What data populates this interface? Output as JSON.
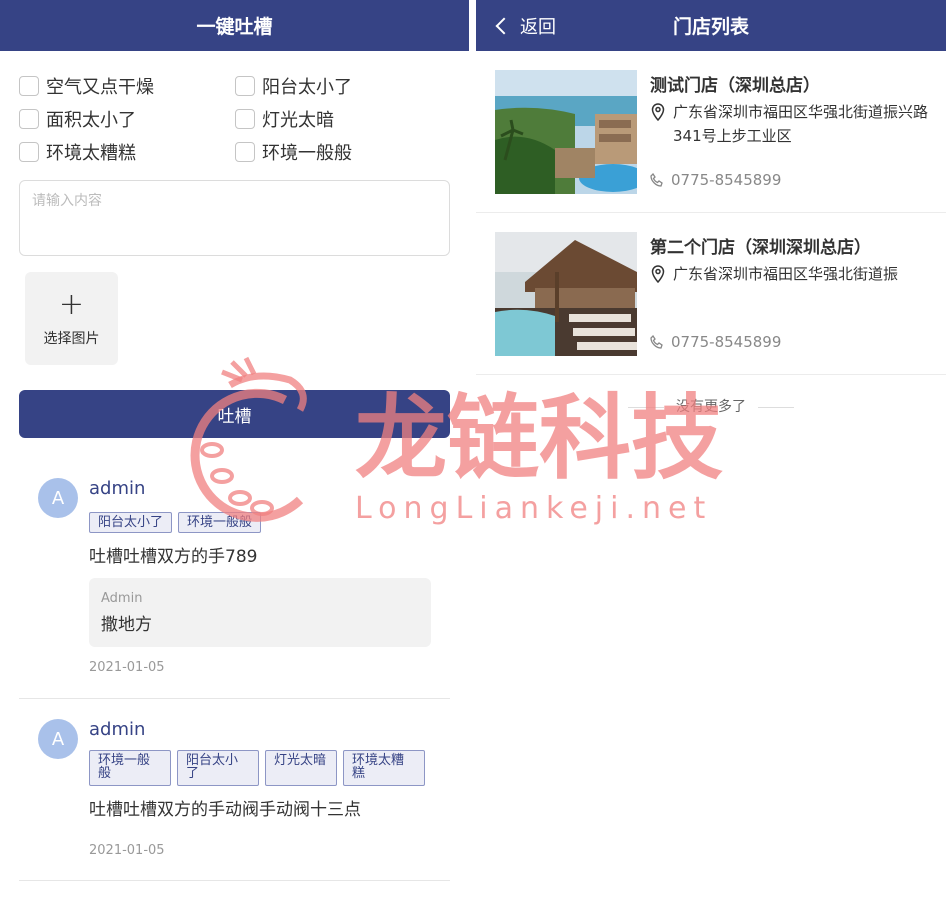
{
  "complain": {
    "title": "一键吐槽",
    "options": [
      "空气又点干燥",
      "阳台太小了",
      "面积太小了",
      "灯光太暗",
      "环境太糟糕",
      "环境一般般"
    ],
    "input_placeholder": "请输入内容",
    "upload_label": "选择图片",
    "submit_label": "吐槽",
    "posts": [
      {
        "avatar_letter": "A",
        "user": "admin",
        "tags": [
          "阳台太小了",
          "环境一般般"
        ],
        "content": "吐槽吐槽双方的手789",
        "reply": {
          "user": "Admin",
          "text": "撒地方"
        },
        "date": "2021-01-05"
      },
      {
        "avatar_letter": "A",
        "user": "admin",
        "tags": [
          "环境一般般",
          "阳台太小了",
          "灯光太暗",
          "环境太糟糕"
        ],
        "content": "吐槽吐槽双方的手动阀手动阀十三点",
        "date": "2021-01-05"
      }
    ]
  },
  "stores": {
    "title": "门店列表",
    "back_label": "返回",
    "items": [
      {
        "name": "测试门店（深圳总店）",
        "address": "广东省深圳市福田区华强北街道振兴路341号上步工业区",
        "phone": "0775-8545899"
      },
      {
        "name": "第二个门店（深圳深圳总店）",
        "address": "广东省深圳市福田区华强北街道振",
        "phone": "0775-8545899"
      }
    ],
    "no_more": "没有更多了"
  },
  "watermark": {
    "title": "龙链科技",
    "url": "LongLiankeji.net"
  },
  "colors": {
    "primary": "#364385",
    "watermark": "#f08080",
    "avatar": "#a9c1ea"
  }
}
